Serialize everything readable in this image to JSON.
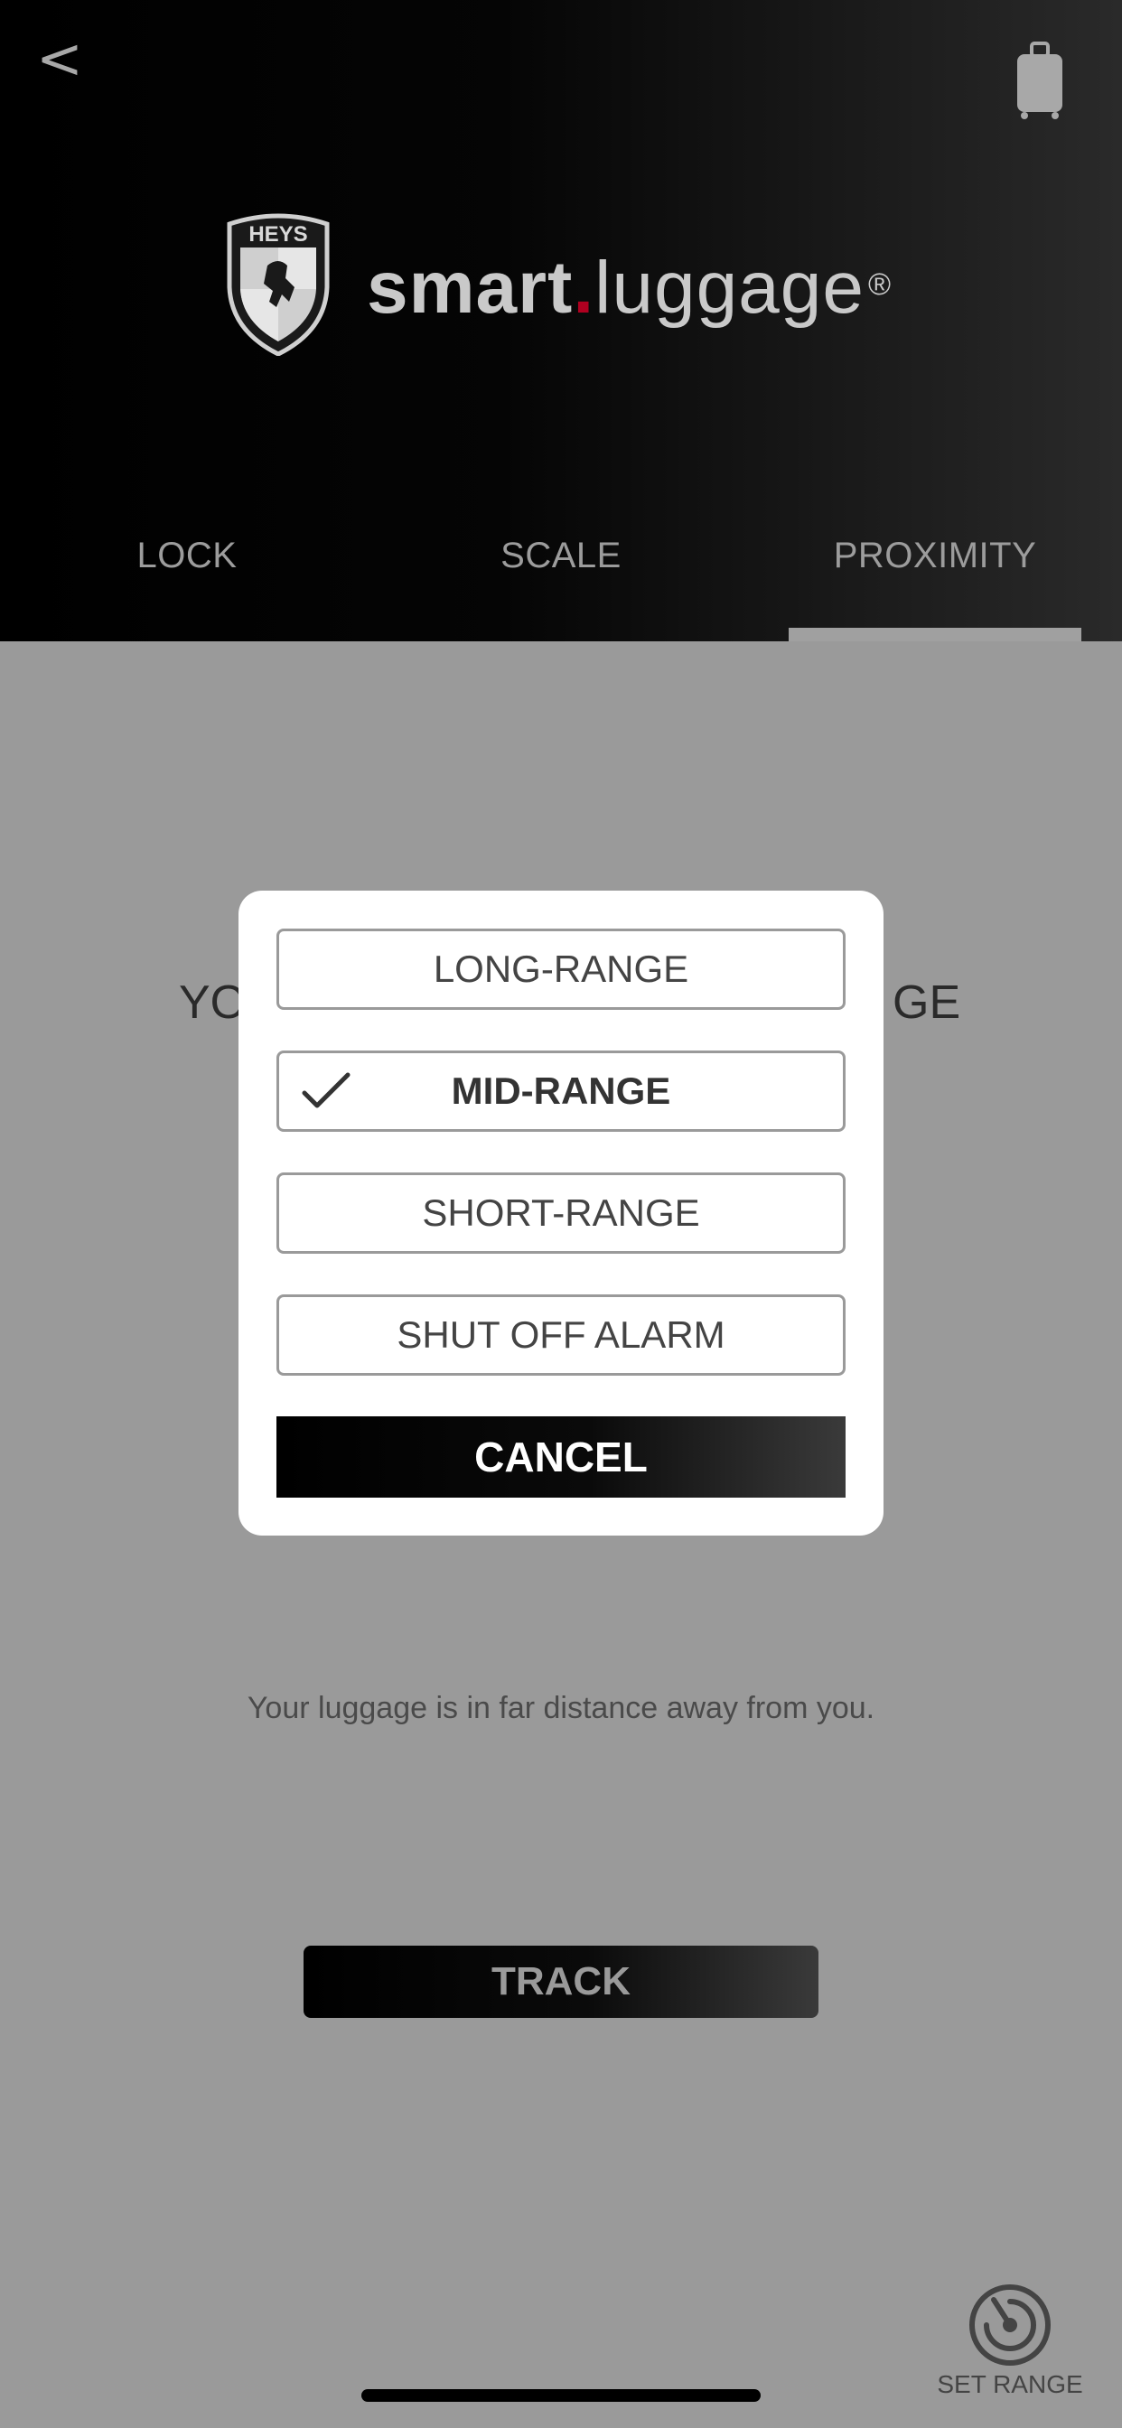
{
  "header": {
    "back_label": "<",
    "back_icon": "chevron-left-icon",
    "device_icon": "suitcase-icon",
    "logo": {
      "shield_text": "HEYS",
      "brand_part1": "smart",
      "brand_dot": ".",
      "brand_part2": "luggage",
      "brand_reg": "®"
    }
  },
  "tabs": [
    {
      "label": "LOCK",
      "active": false
    },
    {
      "label": "SCALE",
      "active": false
    },
    {
      "label": "PROXIMITY",
      "active": true
    }
  ],
  "main": {
    "title_left_fragment": "YO",
    "title_right_fragment": "GE",
    "message": "Your luggage is in far distance away from you.",
    "track_label": "TRACK",
    "set_range_label": "SET RANGE",
    "set_range_icon": "radar-icon"
  },
  "modal": {
    "options": [
      {
        "label": "LONG-RANGE",
        "selected": false
      },
      {
        "label": "MID-RANGE",
        "selected": true
      },
      {
        "label": "SHORT-RANGE",
        "selected": false
      },
      {
        "label": "SHUT OFF ALARM",
        "selected": false
      }
    ],
    "check_icon": "checkmark-icon",
    "cancel_label": "CANCEL"
  },
  "colors": {
    "overlay": "#9a9a9a",
    "header_dark": "#000000",
    "brand_dot": "#b00020",
    "modal_bg": "#ffffff"
  }
}
